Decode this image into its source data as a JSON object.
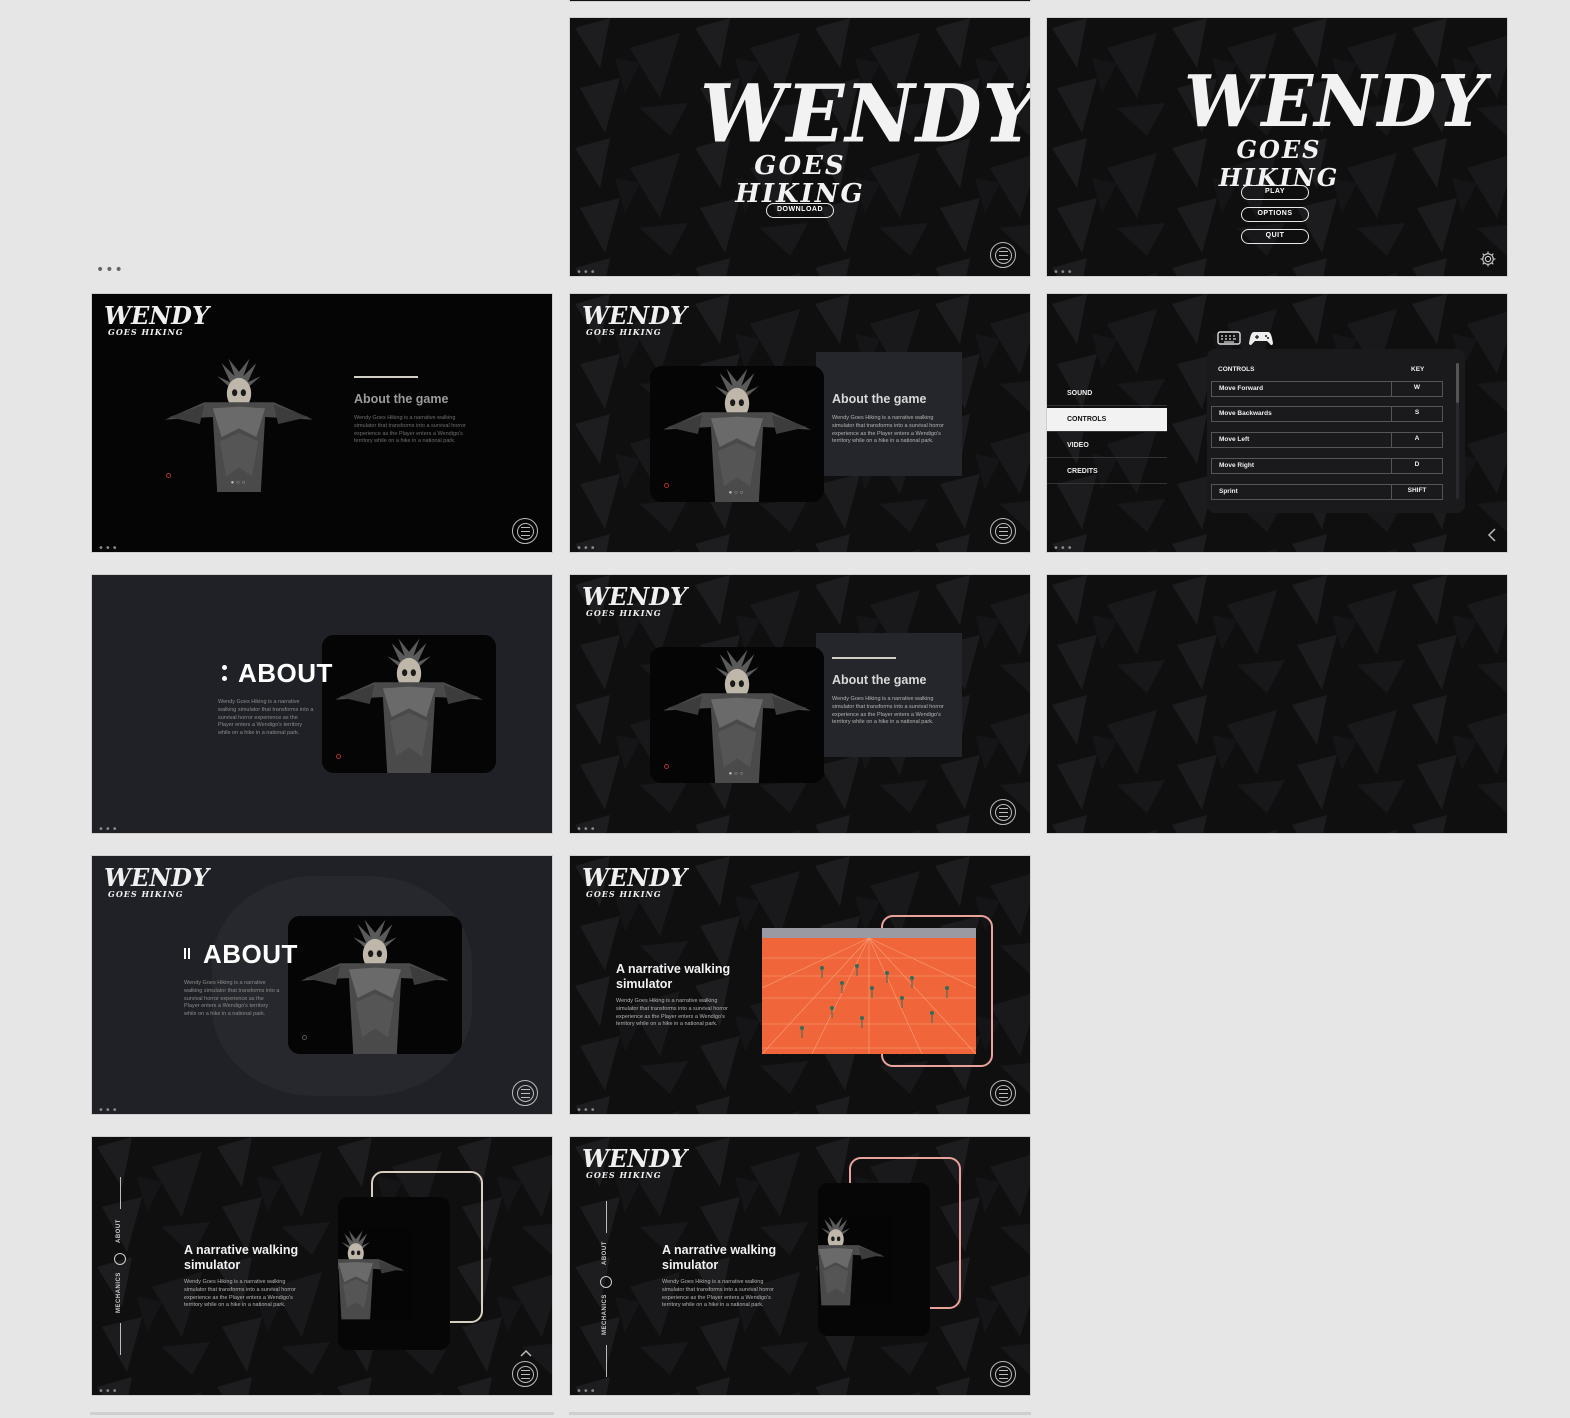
{
  "brand": {
    "title_word": "WENDY",
    "subtitle_words": "GOES HIKING"
  },
  "more_dots": "•••",
  "frames": {
    "download": {
      "download_label": "DOWNLOAD"
    },
    "main_menu": {
      "play_label": "PLAY",
      "options_label": "OPTIONS",
      "quit_label": "QUIT"
    },
    "settings": {
      "tabs": [
        {
          "label": "SOUND"
        },
        {
          "label": "CONTROLS"
        },
        {
          "label": "VIDEO"
        },
        {
          "label": "CREDITS"
        }
      ],
      "active_tab": "CONTROLS",
      "table_headers": {
        "action": "CONTROLS",
        "key": "KEY"
      },
      "rows": [
        {
          "action": "Move Forward",
          "key": "W"
        },
        {
          "action": "Move Backwards",
          "key": "S"
        },
        {
          "action": "Move Left",
          "key": "A"
        },
        {
          "action": "Move Right",
          "key": "D"
        },
        {
          "action": "Sprint",
          "key": "SHIFT"
        }
      ]
    },
    "about": {
      "heading": "About the game",
      "heading_big": "ABOUT",
      "body": "Wendy Goes Hiking is a narrative walking simulator that transforms into a survival horror experience as the Player enters a Wendigo's territory while on a hike in a national park."
    },
    "narrative": {
      "heading": "A narrative walking simulator",
      "body": "Wendy Goes Hiking is a narrative walking simulator that transforms into a survival horror experience as the Player enters a Wendigo's territory while on a hike in a national park.",
      "nav_about": "ABOUT",
      "nav_mechanics": "MECHANICS"
    }
  },
  "colors": {
    "page_bg": "#e6e6e6",
    "art_bg": "#0e0e0f",
    "slate_bg": "#202126",
    "accent_pink": "#e9a39b",
    "accent_beige": "#d9cfc1",
    "game_orange": "#f0663a"
  }
}
